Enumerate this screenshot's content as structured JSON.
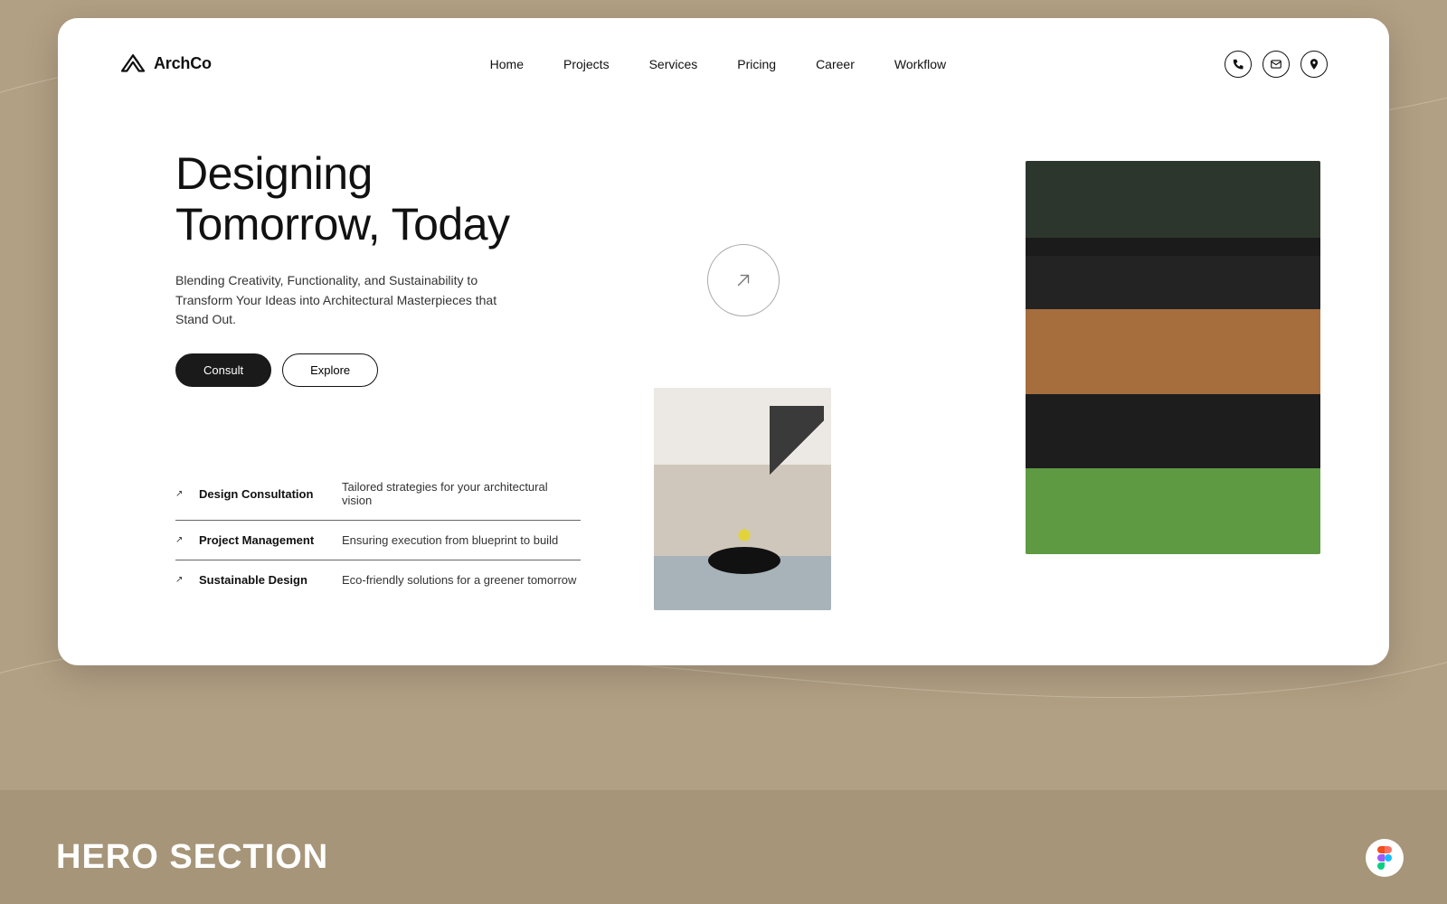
{
  "brand": {
    "name": "ArchCo"
  },
  "nav": {
    "items": [
      {
        "label": "Home"
      },
      {
        "label": "Projects"
      },
      {
        "label": "Services"
      },
      {
        "label": "Pricing"
      },
      {
        "label": "Career"
      },
      {
        "label": "Workflow"
      }
    ]
  },
  "header_icons": {
    "phone": "phone-icon",
    "mail": "mail-icon",
    "location": "location-icon"
  },
  "hero": {
    "title_line1": "Designing",
    "title_line2": "Tomorrow, Today",
    "subhead": "Blending Creativity, Functionality, and Sustainability to Transform Your Ideas into Architectural Masterpieces that Stand Out.",
    "cta_primary": "Consult",
    "cta_secondary": "Explore"
  },
  "services": [
    {
      "title": "Design Consultation",
      "desc": "Tailored strategies for your architectural vision"
    },
    {
      "title": "Project Management",
      "desc": "Ensuring execution from blueprint to build"
    },
    {
      "title": "Sustainable Design",
      "desc": "Eco-friendly solutions for a greener tomorrow"
    }
  ],
  "banner": {
    "title": "HERO SECTION"
  },
  "colors": {
    "page_bg": "#b2a084",
    "banner_bg": "#a69578",
    "card_bg": "#ffffff",
    "text": "#111111",
    "btn_primary_bg": "#1a1a1a"
  }
}
